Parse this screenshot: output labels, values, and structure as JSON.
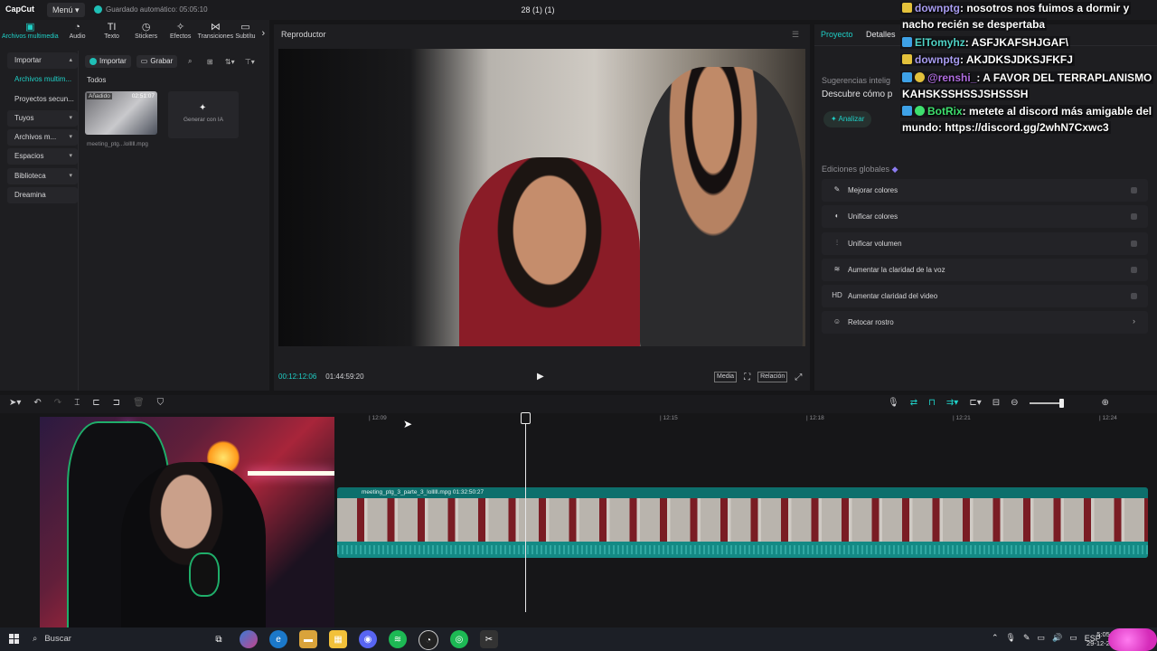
{
  "app": {
    "logo": "CapCut",
    "menu_label": "Menú",
    "autosave": "Guardado automático: 05:05:10",
    "project_title": "28 (1) (1)"
  },
  "toolbar": {
    "tools": [
      {
        "icon": "media-icon",
        "label": "Archivos multimedia"
      },
      {
        "icon": "audio-icon",
        "label": "Audio"
      },
      {
        "icon": "text-icon",
        "label": "Texto"
      },
      {
        "icon": "sticker-icon",
        "label": "Stickers"
      },
      {
        "icon": "effects-icon",
        "label": "Efectos"
      },
      {
        "icon": "transitions-icon",
        "label": "Transiciones"
      },
      {
        "icon": "subtitles-icon",
        "label": "Subtítu"
      }
    ]
  },
  "sidebar": {
    "items": [
      {
        "label": "Importar",
        "chevron": "▴"
      },
      {
        "label": "Archivos multim...",
        "chevron": ""
      },
      {
        "label": "Proyectos secun...",
        "chevron": ""
      },
      {
        "label": "Tuyos",
        "chevron": "▾"
      },
      {
        "label": "Archivos m...",
        "chevron": "▾"
      },
      {
        "label": "Espacios",
        "chevron": "▾"
      },
      {
        "label": "Biblioteca",
        "chevron": "▾"
      },
      {
        "label": "Dreamina",
        "chevron": ""
      }
    ]
  },
  "media": {
    "import_label": "Importar",
    "record_label": "Grabar",
    "section": "Todos",
    "thumb_badge": "Añadido",
    "thumb_duration": "02:51:07",
    "thumb_name": "meeting_ptg...lolllll.mpg",
    "generate_label": "Generar con IA"
  },
  "player": {
    "title": "Reproductor",
    "current_time": "00:12:12:06",
    "total_time": "01:44:59:20",
    "media_label": "Media",
    "ratio_label": "Relación"
  },
  "right_panel": {
    "tab_project": "Proyecto",
    "tab_details": "Detalles",
    "suggestions_title": "Sugerencias intelig",
    "suggestions_body": "Descubre cómo p",
    "analyze_label": "Analizar",
    "global_title": "Ediciones globales",
    "global_items": [
      {
        "icon": "wand-icon",
        "glyph": "✎",
        "label": "Mejorar colores",
        "action": "toggle"
      },
      {
        "icon": "palette-icon",
        "glyph": "◐",
        "label": "Unificar colores",
        "action": "toggle"
      },
      {
        "icon": "volume-bars-icon",
        "glyph": "⫶",
        "label": "Unificar volumen",
        "action": "toggle"
      },
      {
        "icon": "voice-wave-icon",
        "glyph": "≋",
        "label": "Aumentar la claridad de la voz",
        "action": "toggle"
      },
      {
        "icon": "hd-icon",
        "glyph": "HD",
        "label": "Aumentar claridad del video",
        "action": "toggle"
      },
      {
        "icon": "face-icon",
        "glyph": "☺",
        "label": "Retocar rostro",
        "action": "arrow"
      }
    ]
  },
  "chat": {
    "messages": [
      {
        "user": "downptg",
        "user_color": "#a99df2",
        "badge": "#e3c13b",
        "text": ": nosotros nos fuimos a dormir y nacho recién se despertaba"
      },
      {
        "user": "ElTomyhz",
        "user_color": "#4fd1c5",
        "badge": "#3ea1e6",
        "text": ": ASFJKAFSHJGAF\\"
      },
      {
        "user": "downptg",
        "user_color": "#a99df2",
        "badge": "#e3c13b",
        "text": ": AKJDKSJDKSJFKFJ"
      },
      {
        "user": "@renshi_",
        "user_color": "#b06de0",
        "badge": "#3ea1e6",
        "text": ": A FAVOR DEL TERRAPLANISMO KAHSKSSHSSJSHSSSH"
      },
      {
        "user": "BotRix",
        "user_color": "#3ee06e",
        "badge": "#3ea1e6",
        "text": ": metete al discord más amigable del mundo: https://discord.gg/2whN7Cxwc3"
      }
    ]
  },
  "timeline": {
    "ticks": [
      {
        "label": "| 12:09"
      },
      {
        "label": "| 12:15"
      },
      {
        "label": "| 12:18"
      },
      {
        "label": "| 12:21"
      },
      {
        "label": "| 12:24"
      }
    ],
    "clip_label": "meeting_ptg_3_parte_3_lolllll.mpg   01:32:50:27"
  },
  "taskbar": {
    "search_label": "Buscar",
    "language": "ESP",
    "time": "5:05",
    "date": "29-12-2"
  },
  "colors": {
    "accent": "#1fd0c7",
    "clip": "#0d6f6c",
    "background": "#161618"
  }
}
